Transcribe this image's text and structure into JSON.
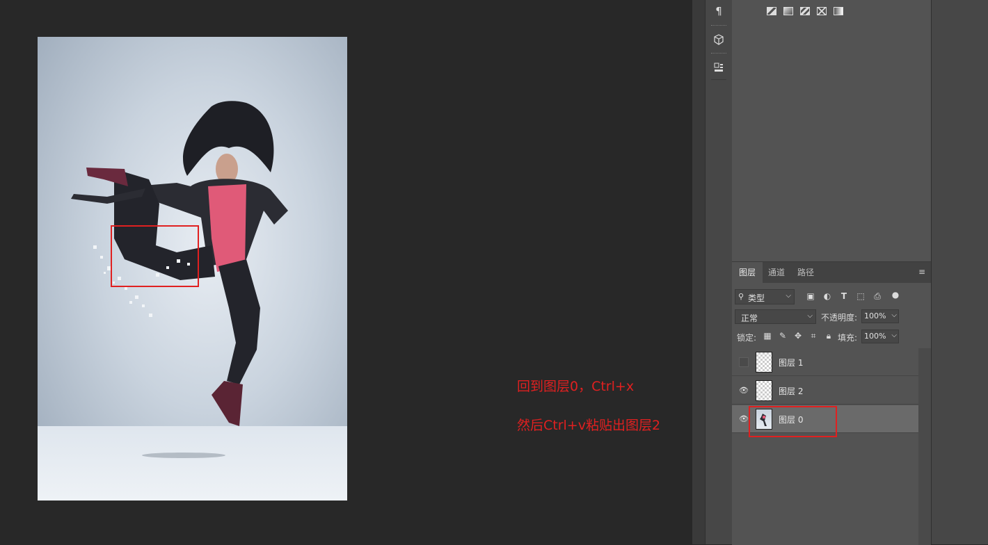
{
  "annotations": {
    "line1": "回到图层0，Ctrl+x",
    "line2": "然后Ctrl+v粘贴出图层2"
  },
  "icon_strip": {
    "icons": [
      "paragraph-icon",
      "3d-cube-icon",
      "3d-materials-icon"
    ]
  },
  "top_panel": {
    "gradient_icons": [
      "gradient-preset-1-icon",
      "gradient-preset-2-icon",
      "gradient-preset-3-icon",
      "gradient-preset-4-icon",
      "gradient-preset-5-icon"
    ]
  },
  "layers_panel": {
    "tabs": [
      "图层",
      "通道",
      "路径"
    ],
    "active_tab": "图层",
    "filter_label": "类型",
    "blend_mode": "正常",
    "opacity_label": "不透明度:",
    "opacity_value": "100%",
    "lock_label": "锁定:",
    "fill_label": "填充:",
    "fill_value": "100%",
    "layers": [
      {
        "name": "图层 1",
        "visible": false,
        "selected": false
      },
      {
        "name": "图层 2",
        "visible": true,
        "selected": false
      },
      {
        "name": "图层 0",
        "visible": true,
        "selected": true
      }
    ]
  },
  "colors": {
    "highlight": "#e02020",
    "panel_bg": "#535353",
    "canvas_bg": "#282828"
  }
}
